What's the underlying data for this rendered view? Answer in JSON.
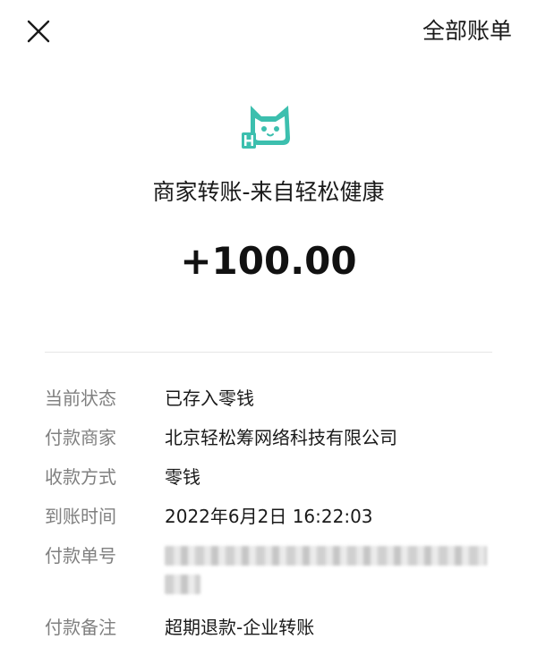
{
  "header": {
    "close_icon": "close-icon",
    "all_bills_label": "全部账单"
  },
  "merchant": {
    "logo_icon": "cat-logo-icon",
    "logo_color": "#3cbfae",
    "title": "商家转账-来自轻松健康"
  },
  "amount": "+100.00",
  "details": {
    "status_label": "当前状态",
    "status_value": "已存入零钱",
    "payer_label": "付款商家",
    "payer_value": "北京轻松筹网络科技有限公司",
    "method_label": "收款方式",
    "method_value": "零钱",
    "time_label": "到账时间",
    "time_value": "2022年6月2日 16:22:03",
    "serial_label": "付款单号",
    "remark_label": "付款备注",
    "remark_value": "超期退款-企业转账"
  }
}
